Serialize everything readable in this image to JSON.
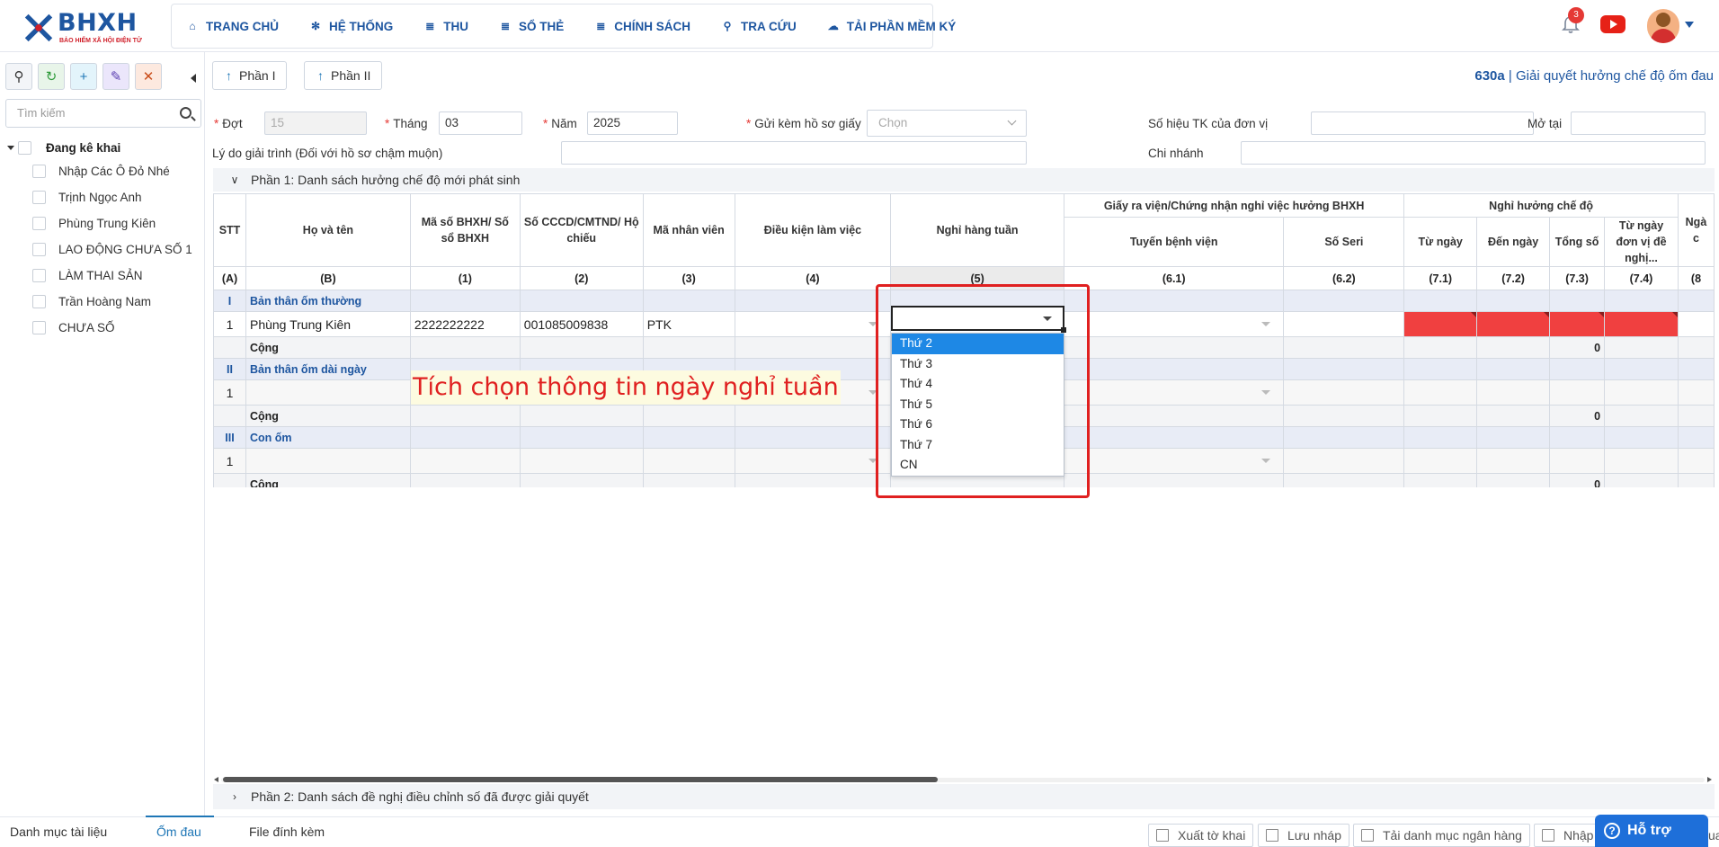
{
  "header": {
    "logo_name": "BHXH",
    "logo_sub": "BẢO HIỂM XÃ HỘI ĐIỆN TỬ",
    "nav": [
      {
        "label": "TRANG CHỦ",
        "icon": "home-icon"
      },
      {
        "label": "HỆ THỐNG",
        "icon": "gear-icon"
      },
      {
        "label": "THU",
        "icon": "document-icon"
      },
      {
        "label": "SỔ THẺ",
        "icon": "card-icon"
      },
      {
        "label": "CHÍNH SÁCH",
        "icon": "policy-icon"
      },
      {
        "label": "TRA CỨU",
        "icon": "search-icon"
      },
      {
        "label": "TẢI PHẦN MỀM KÝ",
        "icon": "cloud-download-icon"
      }
    ],
    "notification_count": "3"
  },
  "sidebar": {
    "search_placeholder": "Tìm kiếm",
    "tree_root": "Đang kê khai",
    "items": [
      "Nhập Các Ô Đỏ Nhé",
      "Trịnh Ngọc Anh",
      "Phùng Trung Kiên",
      "LAO ĐỘNG CHƯA SỐ 1",
      "LÀM THAI SẢN",
      "Trần Hoàng Nam",
      "CHƯA SỐ"
    ]
  },
  "toolbar": {
    "part1": "Phần I",
    "part2": "Phần II"
  },
  "form_title": {
    "code": "630a",
    "separator": " | ",
    "name": "Giải quyết hưởng chế độ ốm đau"
  },
  "form": {
    "dot_label": "Đợt",
    "dot_value": "15",
    "thang_label": "Tháng",
    "thang_value": "03",
    "nam_label": "Năm",
    "nam_value": "2025",
    "gui_kem_label": "Gửi kèm hồ sơ giấy",
    "gui_kem_placeholder": "Chọn",
    "so_hieu_label": "Số hiệu TK của đơn vị",
    "mo_tai_label": "Mở tại",
    "ly_do_label": "Lý do giải trình (Đối với hồ sơ chậm muộn)",
    "chi_nhanh_label": "Chi nhánh"
  },
  "section1": "Phần 1: Danh sách hưởng chế độ mới phát sinh",
  "section2": "Phần 2: Danh sách đề nghị điều chỉnh số đã được giải quyết",
  "table": {
    "headers": {
      "stt": "STT",
      "ho_ten": "Họ và tên",
      "ma_so": "Mã số BHXH/ Số sổ BHXH",
      "cccd": "Số CCCD/CMTND/ Hộ chiếu",
      "ma_nv": "Mã nhân viên",
      "dieu_kien": "Điều kiện làm việc",
      "nghi_tuan": "Nghỉ hàng tuần",
      "giay_ra_vien": "Giấy ra viện/Chứng nhận nghỉ việc hưởng BHXH",
      "tuyen_bv": "Tuyến bệnh viện",
      "so_seri": "Số Seri",
      "nghi_huong": "Nghỉ hưởng chế độ",
      "tu_ngay": "Từ ngày",
      "den_ngay": "Đến ngày",
      "tong_so": "Tổng số",
      "tu_ngay_dn": "Từ ngày đơn vị đề nghị...",
      "cut": "Ngà c"
    },
    "index_row": [
      "(A)",
      "(B)",
      "(1)",
      "(2)",
      "(3)",
      "(4)",
      "(5)",
      "(6.1)",
      "(6.2)",
      "(7.1)",
      "(7.2)",
      "(7.3)",
      "(7.4)",
      "(8"
    ],
    "groups": [
      {
        "roman": "I",
        "name": "Bản thân ốm thường",
        "row": {
          "stt": "1",
          "ho_ten": "Phùng Trung Kiên",
          "ma_so": "2222222222",
          "cccd": "001085009838",
          "ma_nv": "PTK"
        },
        "sum_label": "Cộng",
        "sum_value": "0"
      },
      {
        "roman": "II",
        "name": "Bản thân ốm dài ngày",
        "row": {
          "stt": "1"
        },
        "sum_label": "Cộng",
        "sum_value": "0"
      },
      {
        "roman": "III",
        "name": "Con ốm",
        "row": {
          "stt": "1"
        },
        "sum_label": "Cộng",
        "sum_value": "0"
      }
    ]
  },
  "dropdown_options": [
    "Thứ 2",
    "Thứ 3",
    "Thứ 4",
    "Thứ 5",
    "Thứ 6",
    "Thứ 7",
    "CN"
  ],
  "dropdown_selected": "Thứ 2",
  "annotation": "Tích chọn thông tin ngày nghỉ tuần",
  "bottom": {
    "tabs": [
      "Danh mục tài liệu",
      "Ốm đau",
      "File đính kèm"
    ],
    "active_tab": "Ốm đau",
    "buttons": [
      "Xuất tờ khai",
      "Lưu nháp",
      "Tải danh mục ngân hàng",
      "Nhập",
      "uay lại"
    ],
    "help": "Hỗ trợ"
  },
  "colors": {
    "brand": "#1e56a0",
    "accent": "#1e88e5",
    "highlight_red": "#e02020",
    "error_cell": "#f04040"
  }
}
